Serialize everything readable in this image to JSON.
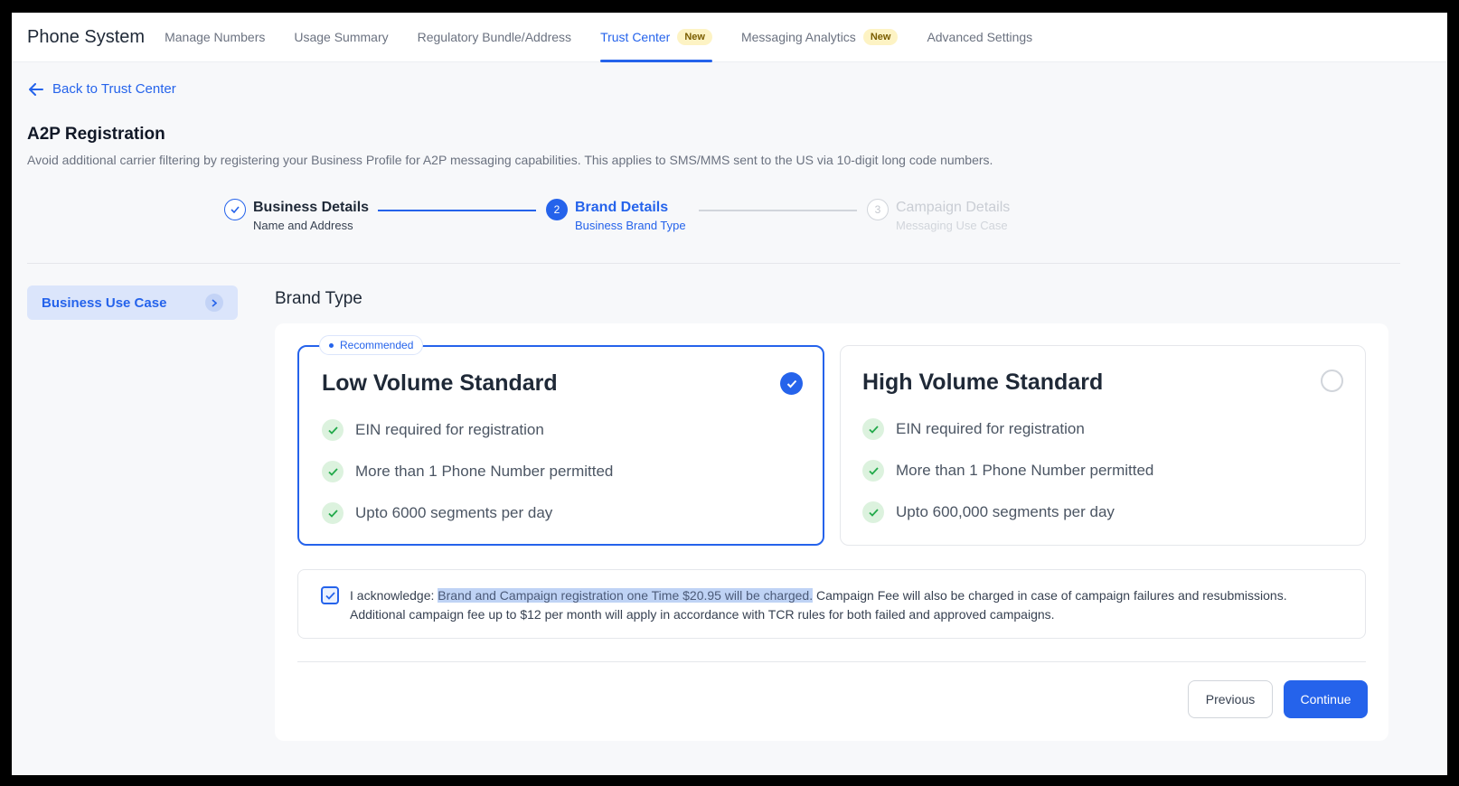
{
  "header": {
    "app_title": "Phone System",
    "tabs": [
      {
        "label": "Manage Numbers",
        "badge": ""
      },
      {
        "label": "Usage Summary",
        "badge": ""
      },
      {
        "label": "Regulatory Bundle/Address",
        "badge": ""
      },
      {
        "label": "Trust Center",
        "badge": "New",
        "active": true
      },
      {
        "label": "Messaging Analytics",
        "badge": "New"
      },
      {
        "label": "Advanced Settings",
        "badge": ""
      }
    ]
  },
  "back_link": "Back to Trust Center",
  "page": {
    "title": "A2P Registration",
    "subtitle": "Avoid additional carrier filtering by registering your Business Profile for A2P messaging capabilities. This applies to SMS/MMS sent to the US via 10-digit long code numbers."
  },
  "stepper": {
    "steps": [
      {
        "number": "1",
        "title": "Business Details",
        "subtitle": "Name and Address",
        "state": "completed"
      },
      {
        "number": "2",
        "title": "Brand Details",
        "subtitle": "Business Brand Type",
        "state": "active"
      },
      {
        "number": "3",
        "title": "Campaign Details",
        "subtitle": "Messaging Use Case",
        "state": "upcoming"
      }
    ]
  },
  "sidebar": {
    "item_label": "Business Use Case"
  },
  "section_title": "Brand Type",
  "cards": [
    {
      "badge": "Recommended",
      "title": "Low Volume Standard",
      "selected": true,
      "features": [
        "EIN required for registration",
        "More than 1 Phone Number permitted",
        "Upto 6000 segments per day"
      ]
    },
    {
      "badge": "",
      "title": "High Volume Standard",
      "selected": false,
      "features": [
        "EIN required for registration",
        "More than 1 Phone Number permitted",
        "Upto 600,000 segments per day"
      ]
    }
  ],
  "acknowledgement": {
    "checked": true,
    "prefix": "I acknowledge: ",
    "highlight": "Brand and Campaign registration one Time $20.95 will be charged.",
    "rest": " Campaign Fee will also be charged in case of campaign failures and resubmissions. Additional campaign fee up to $12 per month will apply in accordance with TCR rules for both failed and approved campaigns."
  },
  "buttons": {
    "previous": "Previous",
    "continue": "Continue"
  },
  "colors": {
    "accent": "#2563eb",
    "badge_new_bg": "#fdf3c4",
    "check_green": "#22a94a",
    "check_green_bg": "#dcf2de"
  }
}
